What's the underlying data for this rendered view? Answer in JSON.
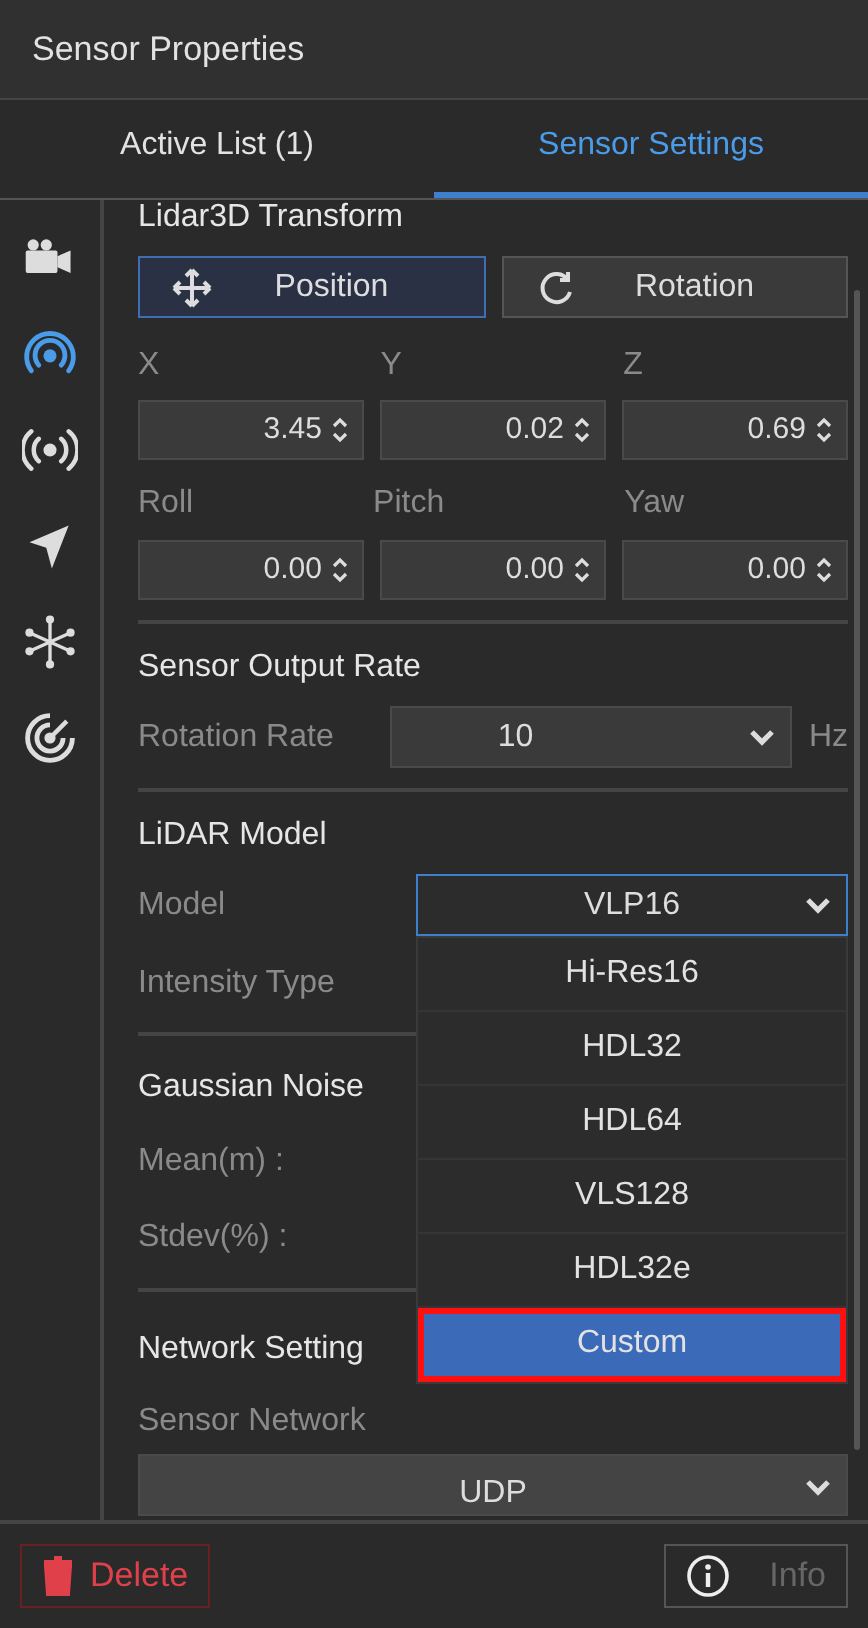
{
  "title": "Sensor Properties",
  "tabs": [
    {
      "label": "Active List (1)",
      "selected": false
    },
    {
      "label": "Sensor Settings",
      "selected": true
    }
  ],
  "rail": [
    {
      "kind": "camera",
      "selected": false
    },
    {
      "kind": "broadcast",
      "selected": true
    },
    {
      "kind": "radio",
      "selected": false
    },
    {
      "kind": "navigation",
      "selected": false
    },
    {
      "kind": "network",
      "selected": false
    },
    {
      "kind": "radar",
      "selected": false
    }
  ],
  "transform": {
    "heading": "Lidar3D Transform",
    "modes": [
      {
        "label": "Position",
        "kind": "move",
        "selected": true
      },
      {
        "label": "Rotation",
        "kind": "rotate",
        "selected": false
      }
    ],
    "rows": [
      [
        {
          "label": "X",
          "value": "3.45"
        },
        {
          "label": "Y",
          "value": "0.02"
        },
        {
          "label": "Z",
          "value": "0.69"
        }
      ],
      [
        {
          "label": "Roll",
          "value": "0.00"
        },
        {
          "label": "Pitch",
          "value": "0.00"
        },
        {
          "label": "Yaw",
          "value": "0.00"
        }
      ]
    ]
  },
  "output_rate": {
    "heading": "Sensor Output Rate",
    "label": "Rotation Rate",
    "value": "10",
    "unit": "Hz"
  },
  "lidar_model": {
    "heading": "LiDAR Model",
    "model_label": "Model",
    "model_value": "VLP16",
    "intensity_label": "Intensity Type",
    "menu": [
      {
        "label": "Hi-Res16",
        "selected": false
      },
      {
        "label": "HDL32",
        "selected": false
      },
      {
        "label": "HDL64",
        "selected": false
      },
      {
        "label": "VLS128",
        "selected": false
      },
      {
        "label": "HDL32e",
        "selected": false
      },
      {
        "label": "Custom",
        "selected": true
      }
    ]
  },
  "gaussian_noise": {
    "heading": "Gaussian Noise",
    "labels": [
      "Mean(m) :",
      "Stdev(%) :"
    ]
  },
  "network": {
    "heading": "Network Setting",
    "label": "Sensor Network",
    "value": "UDP"
  },
  "footer": {
    "delete": "Delete",
    "info": "Info"
  }
}
